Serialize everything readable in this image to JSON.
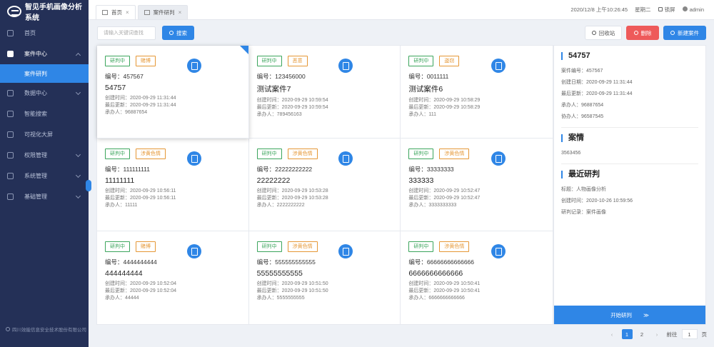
{
  "app": {
    "title": "智见手机画像分析系统"
  },
  "sidebar": {
    "items": [
      {
        "label": "首页"
      },
      {
        "label": "案件中心"
      },
      {
        "label": "数据中心"
      },
      {
        "label": "智能搜索"
      },
      {
        "label": "可视化大屏"
      },
      {
        "label": "权限管理"
      },
      {
        "label": "系统管理"
      },
      {
        "label": "基础管理"
      }
    ],
    "active_sub": "案件研判",
    "footer": "四川效能信息安全技术股份有限公司"
  },
  "tabs": [
    {
      "label": "首页",
      "close": "×"
    },
    {
      "label": "案件研判",
      "close": "×"
    }
  ],
  "topbar": {
    "datetime": "2020/12/8 上午10:26:45",
    "weekday": "星期二",
    "lock": "锁屏",
    "user": "admin"
  },
  "toolbar": {
    "search_placeholder": "请输入关键词查找",
    "search_label": "搜索",
    "recycle_label": "回收站",
    "delete_label": "删除",
    "new_label": "新建案件"
  },
  "cards": [
    {
      "status": "研判中",
      "type": "赌博",
      "no": "编号：457567",
      "title": "54757",
      "created": "创建时间：2020-09-29 11:31:44",
      "updated": "最后更新：2020-09-29 11:31:44",
      "handler": "承办人：96887654"
    },
    {
      "status": "研判中",
      "type": "恶意",
      "no": "编号：123456000",
      "title": "测试案件7",
      "created": "创建时间：2020-09-29 10:59:54",
      "updated": "最后更新：2020-09-29 10:59:54",
      "handler": "承办人：789456163"
    },
    {
      "status": "研判中",
      "type": "盗窃",
      "no": "编号：0011111",
      "title": "测试案件6",
      "created": "创建时间：2020-09-29 10:58:29",
      "updated": "最后更新：2020-09-29 10:58:29",
      "handler": "承办人：111"
    },
    {
      "status": "研判中",
      "type": "涉黄色情",
      "no": "编号：111111111",
      "title": "11111111",
      "created": "创建时间：2020-09-29 10:56:11",
      "updated": "最后更新：2020-09-29 10:56:11",
      "handler": "承办人：11111"
    },
    {
      "status": "研判中",
      "type": "涉黄色情",
      "no": "编号：22222222222",
      "title": "22222222",
      "created": "创建时间：2020-09-29 10:53:28",
      "updated": "最后更新：2020-09-29 10:53:28",
      "handler": "承办人：2222222222"
    },
    {
      "status": "研判中",
      "type": "涉黄色情",
      "no": "编号：33333333",
      "title": "333333",
      "created": "创建时间：2020-09-29 10:52:47",
      "updated": "最后更新：2020-09-29 10:52:47",
      "handler": "承办人：3333333333"
    },
    {
      "status": "研判中",
      "type": "赌博",
      "no": "编号：4444444444",
      "title": "444444444",
      "created": "创建时间：2020-09-29 10:52:04",
      "updated": "最后更新：2020-09-29 10:52:04",
      "handler": "承办人：44444"
    },
    {
      "status": "研判中",
      "type": "涉黄色情",
      "no": "编号：555555555555",
      "title": "55555555555",
      "created": "创建时间：2020-09-29 10:51:50",
      "updated": "最后更新：2020-09-29 10:51:50",
      "handler": "承办人：5555555555"
    },
    {
      "status": "研判中",
      "type": "涉黄色情",
      "no": "编号：66666666666666",
      "title": "6666666666666",
      "created": "创建时间：2020-09-29 10:50:41",
      "updated": "最后更新：2020-09-29 10:50:41",
      "handler": "承办人：6666666666666"
    }
  ],
  "detail": {
    "title": "54757",
    "case_no": "案件编号：457567",
    "created": "创建日期：2020-09-29 11:31:44",
    "updated": "最后更新：2020-09-29 11:31:44",
    "handler": "承办人：96887654",
    "assistant": "协办人：96587545",
    "case_heading": "案情",
    "case_text": "3563456",
    "recent_heading": "最近研判",
    "recent_topic": "标题：人物画像分析",
    "recent_time": "创建时间：2020-10-26 10:59:56",
    "recent_record": "研判记录：案件画像",
    "start_label": "开始研判",
    "start_arrow": "≫"
  },
  "pagination": {
    "prev": "‹",
    "pages": [
      "1",
      "2"
    ],
    "next": "›",
    "goto_label": "前往",
    "goto_value": "1",
    "page_unit": "页"
  },
  "colors": {
    "primary": "#2f86e6",
    "sidebar": "#243057",
    "danger": "#ee5a5a",
    "status": "#3ba55c",
    "type": "#e59735"
  }
}
